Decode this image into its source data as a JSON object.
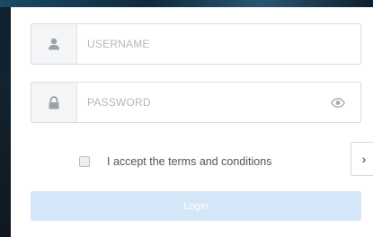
{
  "login_form": {
    "username": {
      "placeholder": "USERNAME",
      "value": "",
      "icon": "user-icon"
    },
    "password": {
      "placeholder": "PASSWORD",
      "value": "",
      "icon": "lock-icon",
      "toggle_icon": "eye-icon"
    },
    "terms": {
      "label": "I accept the terms and conditions",
      "checked": false
    },
    "next_arrow": "›",
    "login_label": "Login"
  },
  "colors": {
    "login_button": "#d4e6f7",
    "icon_gray": "#9aa1a9",
    "field_border": "#d9dde2"
  }
}
